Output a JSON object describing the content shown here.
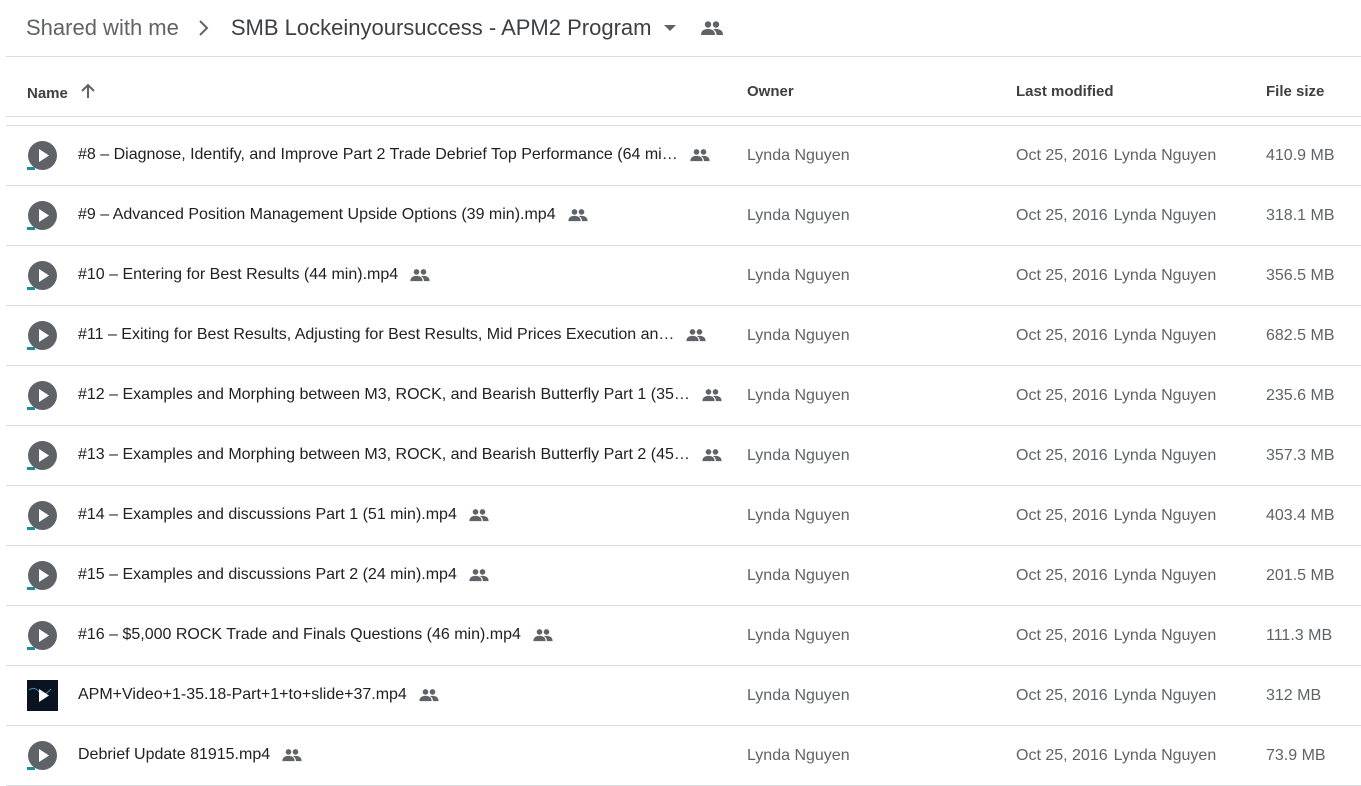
{
  "breadcrumb": {
    "root": "Shared with me",
    "current": "SMB Lockeinyoursuccess - APM2 Program"
  },
  "columns": {
    "name": "Name",
    "owner": "Owner",
    "modified": "Last modified",
    "size": "File size"
  },
  "colors": {
    "text_primary": "#202124",
    "text_secondary": "#5f6368",
    "divider": "#dadce0",
    "icon": "#5f6368",
    "video_accent": "#1e8e9e"
  },
  "files": [
    {
      "name": "#8 – Diagnose, Identify, and Improve Part 2  Trade Debrief  Top Performance (64 mi…",
      "owner": "Lynda Nguyen",
      "modified_date": "Oct 25, 2016",
      "modified_by": "Lynda Nguyen",
      "size": "410.9 MB",
      "thumb": "video-icon"
    },
    {
      "name": "#9 – Advanced Position Management Upside Options  (39 min).mp4",
      "owner": "Lynda Nguyen",
      "modified_date": "Oct 25, 2016",
      "modified_by": "Lynda Nguyen",
      "size": "318.1 MB",
      "thumb": "video-icon"
    },
    {
      "name": "#10 – Entering for Best Results (44 min).mp4",
      "owner": "Lynda Nguyen",
      "modified_date": "Oct 25, 2016",
      "modified_by": "Lynda Nguyen",
      "size": "356.5 MB",
      "thumb": "video-icon"
    },
    {
      "name": "#11 – Exiting for Best Results, Adjusting for Best Results, Mid Prices Execution an…",
      "owner": "Lynda Nguyen",
      "modified_date": "Oct 25, 2016",
      "modified_by": "Lynda Nguyen",
      "size": "682.5 MB",
      "thumb": "video-icon"
    },
    {
      "name": "#12 – Examples and Morphing between M3, ROCK, and Bearish Butterfly Part 1 (35…",
      "owner": "Lynda Nguyen",
      "modified_date": "Oct 25, 2016",
      "modified_by": "Lynda Nguyen",
      "size": "235.6 MB",
      "thumb": "video-icon"
    },
    {
      "name": "#13 – Examples and Morphing between M3, ROCK, and Bearish Butterfly Part 2 (45…",
      "owner": "Lynda Nguyen",
      "modified_date": "Oct 25, 2016",
      "modified_by": "Lynda Nguyen",
      "size": "357.3 MB",
      "thumb": "video-icon"
    },
    {
      "name": "#14 – Examples and discussions Part 1 (51 min).mp4",
      "owner": "Lynda Nguyen",
      "modified_date": "Oct 25, 2016",
      "modified_by": "Lynda Nguyen",
      "size": "403.4 MB",
      "thumb": "video-icon"
    },
    {
      "name": "#15 – Examples and discussions Part 2 (24 min).mp4",
      "owner": "Lynda Nguyen",
      "modified_date": "Oct 25, 2016",
      "modified_by": "Lynda Nguyen",
      "size": "201.5 MB",
      "thumb": "video-icon"
    },
    {
      "name": "#16 – $5,000 ROCK Trade and Finals Questions (46 min).mp4",
      "owner": "Lynda Nguyen",
      "modified_date": "Oct 25, 2016",
      "modified_by": "Lynda Nguyen",
      "size": "111.3 MB",
      "thumb": "video-icon"
    },
    {
      "name": "APM+Video+1-35.18-Part+1+to+slide+37.mp4",
      "owner": "Lynda Nguyen",
      "modified_date": "Oct 25, 2016",
      "modified_by": "Lynda Nguyen",
      "size": "312 MB",
      "thumb": "video-thumbnail-dark"
    },
    {
      "name": "Debrief Update 81915.mp4",
      "owner": "Lynda Nguyen",
      "modified_date": "Oct 25, 2016",
      "modified_by": "Lynda Nguyen",
      "size": "73.9 MB",
      "thumb": "video-icon"
    }
  ]
}
